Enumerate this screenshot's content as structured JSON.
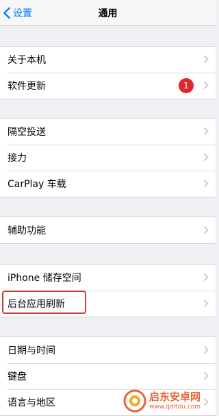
{
  "navbar": {
    "back_label": "设置",
    "title": "通用"
  },
  "groups": {
    "g1": [
      {
        "label": "关于本机"
      },
      {
        "label": "软件更新",
        "badge": "1"
      }
    ],
    "g2": [
      {
        "label": "隔空投送"
      },
      {
        "label": "接力"
      },
      {
        "label": "CarPlay 车载"
      }
    ],
    "g3": [
      {
        "label": "辅助功能"
      }
    ],
    "g4": [
      {
        "label": "iPhone 储存空间"
      },
      {
        "label": "后台应用刷新"
      }
    ],
    "g5": [
      {
        "label": "日期与时间"
      },
      {
        "label": "键盘"
      },
      {
        "label": "语言与地区"
      }
    ]
  },
  "colors": {
    "accent": "#007aff",
    "badge": "#e0272e",
    "highlight": "#c93a2e",
    "background": "#efeff4"
  },
  "icons": {
    "back": "chevron-left-icon",
    "row": "chevron-right-icon"
  },
  "watermark": {
    "title": "启东安卓网",
    "url": "www.qdltdu.com"
  }
}
